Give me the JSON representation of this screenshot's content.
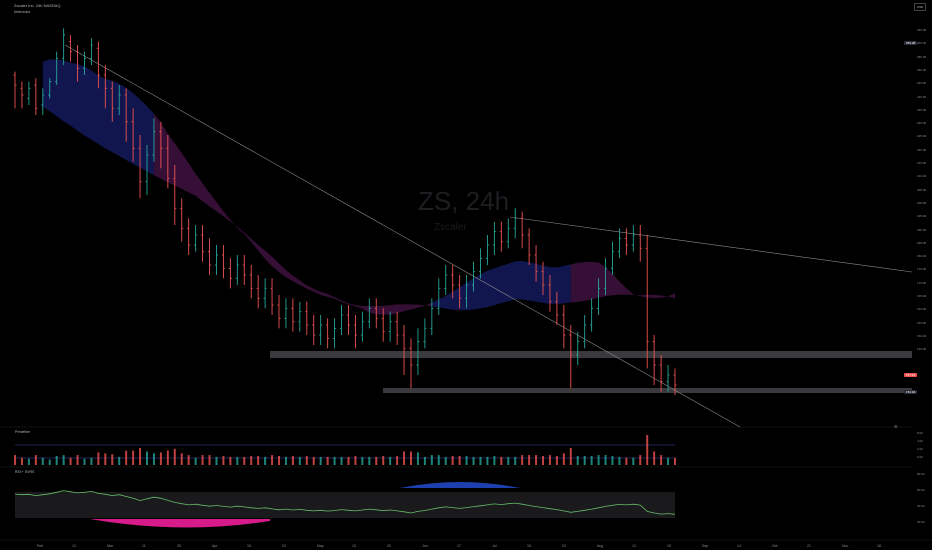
{
  "header": {
    "title": "Zscaler Inc. 24h NASDAQ",
    "subtitle": "Ichimoku"
  },
  "watermark": {
    "symbol": "ZS, 24h",
    "name": "Zscaler"
  },
  "currency": "USD",
  "price_axis": [
    "265.00",
    "260.00",
    "255.00",
    "250.00",
    "245.00",
    "240.00",
    "235.00",
    "230.00",
    "225.00",
    "220.00",
    "215.00",
    "210.00",
    "205.00",
    "200.00",
    "195.00",
    "190.00",
    "185.00",
    "180.00",
    "175.00",
    "170.00",
    "165.00",
    "160.00",
    "155.00",
    "150.00",
    "145.00"
  ],
  "price_badges": {
    "high": "253.28",
    "current": "157.10",
    "low": "153.94"
  },
  "date_axis": [
    "Feb",
    "12",
    "Mar",
    "11",
    "25",
    "Apr",
    "15",
    "22",
    "May",
    "13",
    "20",
    "Jun",
    "17",
    "Jul",
    "15",
    "22",
    "Aug",
    "12",
    "19",
    "Sep",
    "14",
    "Oct",
    "21",
    "Nov",
    "18"
  ],
  "pane2": {
    "label": "Predefine",
    "ticks": [
      "8.00",
      "4.00",
      "2.00",
      "0.00"
    ]
  },
  "pane3": {
    "label": "RSI + SVRS",
    "ticks": [
      "80.00",
      "60.00",
      "40.00",
      "20.00"
    ]
  },
  "colors": {
    "up": "#26a69a",
    "down": "#ef5350",
    "cloud_blue": "#141a5c",
    "cloud_purple": "#3f1240",
    "grey_zone": "#3a3a3e",
    "trend": "#8a8a8a",
    "rsi_magenta": "#d81b8a",
    "background": "#000000"
  },
  "chart_data": {
    "type": "candlestick",
    "x_range": [
      "Feb",
      "Nov"
    ],
    "ylim": [
      145,
      265
    ],
    "candles": [
      [
        250,
        247,
        251,
        240
      ],
      [
        246,
        244,
        248,
        240
      ],
      [
        243,
        246,
        248,
        241
      ],
      [
        247,
        240,
        249,
        238
      ],
      [
        241,
        244,
        246,
        238
      ],
      [
        244,
        248,
        249,
        243
      ],
      [
        248,
        255,
        257,
        247
      ],
      [
        255,
        262,
        264,
        253
      ],
      [
        260,
        257,
        262,
        254
      ],
      [
        257,
        252,
        259,
        248
      ],
      [
        252,
        255,
        257,
        250
      ],
      [
        255,
        259,
        261,
        253
      ],
      [
        258,
        250,
        260,
        246
      ],
      [
        250,
        246,
        253,
        240
      ],
      [
        246,
        240,
        248,
        236
      ],
      [
        240,
        244,
        247,
        238
      ],
      [
        244,
        236,
        246,
        230
      ],
      [
        236,
        228,
        240,
        224
      ],
      [
        228,
        218,
        232,
        213
      ],
      [
        218,
        226,
        229,
        214
      ],
      [
        226,
        233,
        237,
        224
      ],
      [
        233,
        228,
        236,
        222
      ],
      [
        228,
        219,
        232,
        216
      ],
      [
        219,
        210,
        223,
        205
      ],
      [
        210,
        204,
        213,
        200
      ],
      [
        204,
        199,
        207,
        196
      ],
      [
        199,
        202,
        205,
        197
      ],
      [
        202,
        197,
        205,
        194
      ],
      [
        197,
        193,
        201,
        190
      ],
      [
        193,
        196,
        199,
        190
      ],
      [
        196,
        192,
        199,
        189
      ],
      [
        192,
        189,
        195,
        186
      ],
      [
        189,
        193,
        196,
        187
      ],
      [
        193,
        190,
        196,
        187
      ],
      [
        190,
        186,
        193,
        183
      ],
      [
        186,
        183,
        190,
        180
      ],
      [
        183,
        186,
        189,
        180
      ],
      [
        186,
        181,
        189,
        178
      ],
      [
        181,
        177,
        184,
        174
      ],
      [
        177,
        180,
        183,
        174
      ],
      [
        180,
        176,
        183,
        173
      ],
      [
        176,
        179,
        182,
        173
      ],
      [
        179,
        175,
        182,
        172
      ],
      [
        175,
        172,
        178,
        169
      ],
      [
        172,
        175,
        178,
        169
      ],
      [
        175,
        171,
        177,
        168
      ],
      [
        171,
        174,
        177,
        168
      ],
      [
        174,
        178,
        181,
        172
      ],
      [
        178,
        175,
        181,
        172
      ],
      [
        175,
        172,
        178,
        168
      ],
      [
        172,
        176,
        179,
        170
      ],
      [
        176,
        180,
        183,
        174
      ],
      [
        180,
        177,
        183,
        174
      ],
      [
        177,
        173,
        180,
        170
      ],
      [
        173,
        176,
        179,
        170
      ],
      [
        176,
        172,
        179,
        169
      ],
      [
        172,
        168,
        175,
        160
      ],
      [
        168,
        163,
        171,
        156
      ],
      [
        163,
        170,
        174,
        160
      ],
      [
        170,
        174,
        177,
        168
      ],
      [
        174,
        180,
        183,
        172
      ],
      [
        180,
        186,
        189,
        178
      ],
      [
        186,
        190,
        193,
        184
      ],
      [
        190,
        187,
        193,
        183
      ],
      [
        187,
        183,
        190,
        180
      ],
      [
        183,
        187,
        190,
        180
      ],
      [
        187,
        191,
        194,
        185
      ],
      [
        191,
        195,
        198,
        189
      ],
      [
        195,
        199,
        202,
        193
      ],
      [
        199,
        203,
        206,
        196
      ],
      [
        203,
        200,
        206,
        197
      ],
      [
        200,
        204,
        207,
        198
      ],
      [
        204,
        207,
        210,
        201
      ],
      [
        207,
        202,
        209,
        198
      ],
      [
        202,
        196,
        204,
        193
      ],
      [
        196,
        191,
        199,
        188
      ],
      [
        191,
        187,
        194,
        184
      ],
      [
        187,
        182,
        190,
        179
      ],
      [
        182,
        178,
        185,
        175
      ],
      [
        178,
        172,
        181,
        168
      ],
      [
        172,
        166,
        175,
        156
      ],
      [
        166,
        170,
        173,
        163
      ],
      [
        170,
        175,
        178,
        168
      ],
      [
        175,
        180,
        183,
        173
      ],
      [
        180,
        186,
        189,
        178
      ],
      [
        186,
        192,
        195,
        184
      ],
      [
        192,
        197,
        200,
        190
      ],
      [
        197,
        201,
        204,
        195
      ],
      [
        201,
        199,
        204,
        196
      ],
      [
        199,
        202,
        205,
        197
      ],
      [
        202,
        198,
        205,
        194
      ],
      [
        198,
        170,
        202,
        162
      ],
      [
        170,
        163,
        172,
        157
      ],
      [
        163,
        158,
        166,
        155
      ],
      [
        158,
        160,
        163,
        155
      ],
      [
        160,
        157,
        162,
        154
      ]
    ]
  }
}
